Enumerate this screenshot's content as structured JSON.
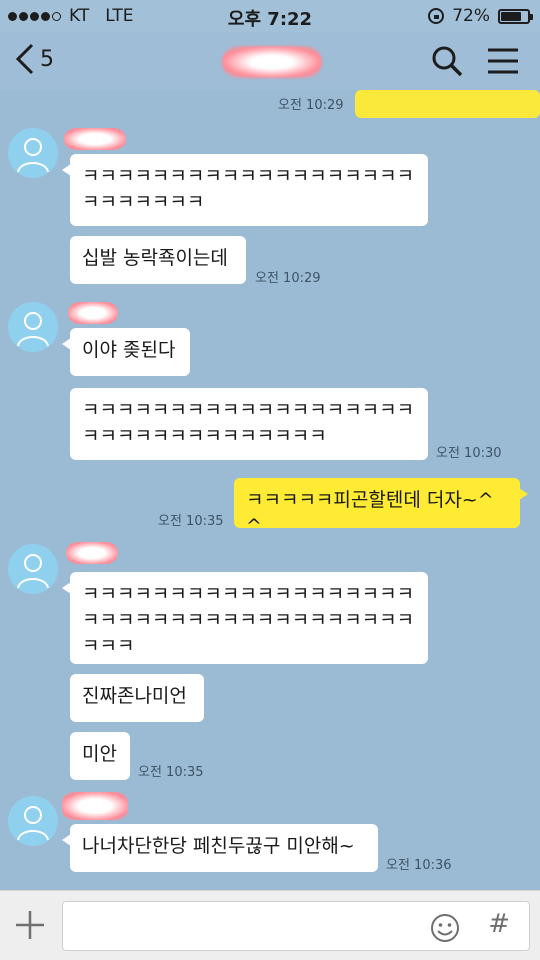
{
  "status_bar": {
    "carrier": "KT",
    "network": "LTE",
    "time": "오후 7:22",
    "battery_percent": "72%",
    "battery_level": 0.72
  },
  "header": {
    "back_count": "5"
  },
  "messages": [
    {
      "text": "ㅋㅋㅋㅋㅋㅋㅋㅋㅋㅋㅋㅋㅋㅋㅋㅋㅋㅋㅋ\nㅋㅋㅋㅋㅋㅋㅋ"
    },
    {
      "text": "십발 농락죡이는데",
      "time": "오전 10:29"
    },
    {
      "text": "이야 좆된다"
    },
    {
      "text": "ㅋㅋㅋㅋㅋㅋㅋㅋㅋㅋㅋㅋㅋㅋㅋㅋㅋㅋㅋ\nㅋㅋㅋㅋㅋㅋㅋㅋㅋㅋㅋㅋㅋㅋ",
      "time": "오전 10:30"
    },
    {
      "text": "ㅋㅋㅋㅋㅋ피곤할텐데 더자~^^",
      "time": "오전 10:35"
    },
    {
      "text": "ㅋㅋㅋㅋㅋㅋㅋㅋㅋㅋㅋㅋㅋㅋㅋㅋㅋㅋㅋ\nㅋㅋㅋㅋㅋㅋㅋㅋㅋㅋㅋㅋㅋㅋㅋㅋㅋㅋㅋ\nㅋㅋㅋ"
    },
    {
      "text": "진짜존나미언"
    },
    {
      "text": "미안",
      "time": "오전 10:35"
    },
    {
      "text": "나너차단한당 페친두끊구 미안해~",
      "time": "오전 10:36"
    }
  ],
  "top_partial_time": "오전 10:29",
  "icons": {
    "back": "chevron-left-icon",
    "search": "search-icon",
    "menu": "hamburger-menu-icon",
    "plus": "plus-icon",
    "emoji": "smiley-icon",
    "hash": "hash-icon",
    "avatar": "default-profile-icon"
  },
  "input_bar": {
    "hash_label": "#"
  },
  "colors": {
    "background": "#9bbbd4",
    "my_bubble": "#ffeb33",
    "their_bubble": "#ffffff",
    "avatar": "#8fd0ef"
  }
}
